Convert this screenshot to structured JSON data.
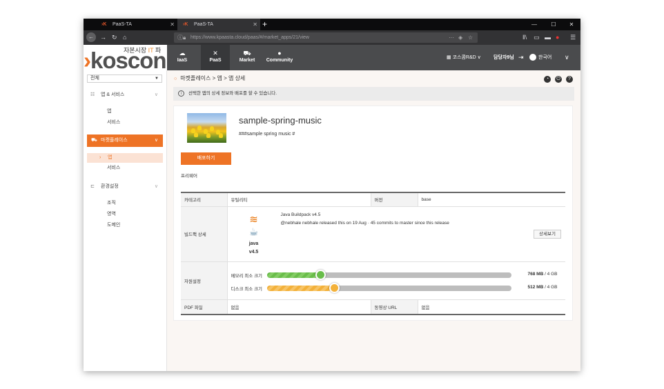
{
  "browser": {
    "tabs": [
      {
        "label": "PaaS-TA"
      },
      {
        "label": "PaaS-TA"
      }
    ],
    "new_tab": "+",
    "url_domain": "https://www.kpaasta.cloud",
    "url_path": "/paas/#/market_apps/21/view"
  },
  "header": {
    "logo_subtitle": "자본시장",
    "logo_subtitle_accent": "IT",
    "logo_subtitle_end": "파",
    "logo_mark": "›",
    "logo_text": "koscon",
    "nav": [
      {
        "label": "IaaS",
        "icon": "cloud-icon"
      },
      {
        "label": "PaaS",
        "icon": "tools-icon"
      },
      {
        "label": "Market",
        "icon": "cart-icon"
      },
      {
        "label": "Community",
        "icon": "chat-icon"
      }
    ],
    "org": "코스콤R&D",
    "user": "담당자9님",
    "language": "한국어"
  },
  "sidebar": {
    "select_value": "전체",
    "sections": [
      {
        "label": "앱 & 서비스",
        "items": [
          "앱",
          "서비스"
        ]
      },
      {
        "label": "마켓플레이스",
        "items": [
          "앱",
          "서비스"
        ]
      },
      {
        "label": "환경설정",
        "items": [
          "조직",
          "영역",
          "도메인"
        ]
      }
    ],
    "active_item": "앱"
  },
  "main": {
    "breadcrumb": "마켓플레이스 > 앱 > 앱 상세",
    "info_text": "선택한 앱의 상세 정보와 배포를 할 수 있습니다.",
    "app_name": "sample-spring-music",
    "app_description": "###sample spring music #",
    "deploy_button": "배포하기",
    "license": "프리웨어",
    "table": {
      "category_label": "카테고리",
      "category_value": "유틸리티",
      "version_label": "버전",
      "version_value": "base",
      "buildpack_label": "빌드팩 상세",
      "buildpack_name": "java",
      "buildpack_version": "v4.5",
      "buildpack_title": "Java Buildpack v4.5",
      "buildpack_message": "@nebhale nebhale released this on 19 Aug · 45 commits to master since this release",
      "detail_button": "상세보기",
      "resource_label": "자원설정",
      "memory_label": "메모리 최소 크기",
      "memory_value": "768 MB",
      "memory_max": " / 4 GB",
      "memory_fraction": 0.1875,
      "disk_label": "디스크 최소 크기",
      "disk_value": "512 MB",
      "disk_max": " / 4 GB",
      "disk_fraction": 0.125,
      "pdf_label": "PDF 파일",
      "pdf_value": "없음",
      "video_label": "동영상 URL",
      "video_value": "없음"
    }
  },
  "colors": {
    "accent": "#ee7325",
    "memory": "#69bd4a",
    "disk": "#f3b13a"
  }
}
